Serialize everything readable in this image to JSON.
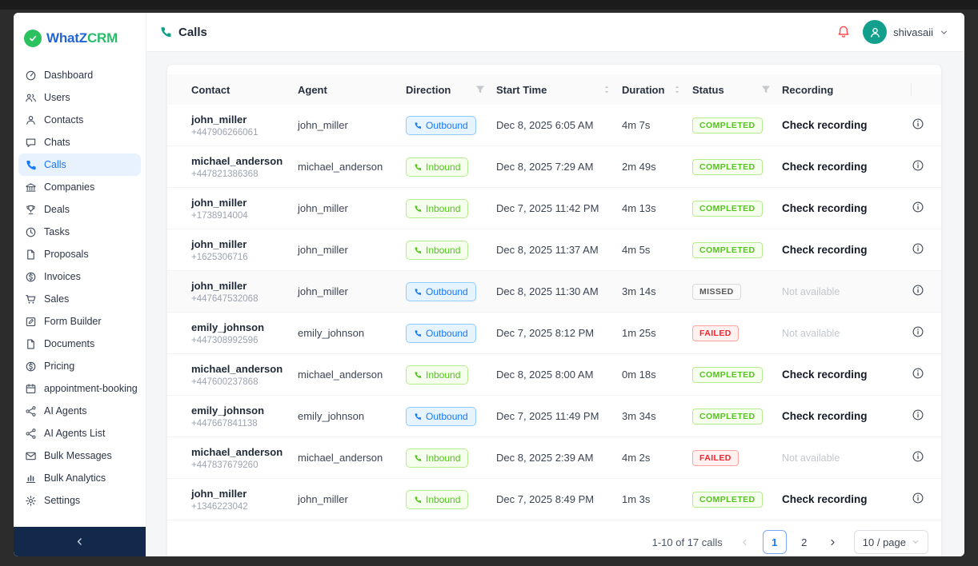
{
  "colors": {
    "accent": "#1677ff",
    "logo_blue": "#2465d6",
    "logo_green": "#27bd68",
    "brand_green": "#2bc15f",
    "teal": "#12a08d",
    "bell_red": "#ff4d4f",
    "navy": "#13294b",
    "sidebar_active_bg": "#e7f2fe"
  },
  "logo": {
    "part1": "WhatZ",
    "part2": "CRM"
  },
  "sidebar": {
    "items": [
      {
        "label": "Dashboard",
        "icon": "dashboard-icon",
        "active": false
      },
      {
        "label": "Users",
        "icon": "team-icon",
        "active": false
      },
      {
        "label": "Contacts",
        "icon": "contact-icon",
        "active": false
      },
      {
        "label": "Chats",
        "icon": "chat-icon",
        "active": false
      },
      {
        "label": "Calls",
        "icon": "phone-icon",
        "active": true
      },
      {
        "label": "Companies",
        "icon": "bank-icon",
        "active": false
      },
      {
        "label": "Deals",
        "icon": "trophy-icon",
        "active": false
      },
      {
        "label": "Tasks",
        "icon": "clock-icon",
        "active": false
      },
      {
        "label": "Proposals",
        "icon": "file-icon",
        "active": false
      },
      {
        "label": "Invoices",
        "icon": "dollar-icon",
        "active": false
      },
      {
        "label": "Sales",
        "icon": "cart-icon",
        "active": false
      },
      {
        "label": "Form Builder",
        "icon": "form-icon",
        "active": false
      },
      {
        "label": "Documents",
        "icon": "file-icon",
        "active": false
      },
      {
        "label": "Pricing",
        "icon": "dollar-icon",
        "active": false
      },
      {
        "label": "appointment-booking",
        "icon": "calendar-icon",
        "active": false
      },
      {
        "label": "AI Agents",
        "icon": "nodes-icon",
        "active": false
      },
      {
        "label": "AI Agents List",
        "icon": "nodes-icon",
        "active": false
      },
      {
        "label": "Bulk Messages",
        "icon": "mail-icon",
        "active": false
      },
      {
        "label": "Bulk Analytics",
        "icon": "chart-icon",
        "active": false
      },
      {
        "label": "Settings",
        "icon": "gear-icon",
        "active": false
      }
    ]
  },
  "header": {
    "title": "Calls",
    "user": "shivasaii"
  },
  "table": {
    "columns": [
      {
        "label": "Contact",
        "control": null
      },
      {
        "label": "Agent",
        "control": null
      },
      {
        "label": "Direction",
        "control": "filter"
      },
      {
        "label": "Start Time",
        "control": "sorter"
      },
      {
        "label": "Duration",
        "control": "sorter"
      },
      {
        "label": "Status",
        "control": "filter"
      },
      {
        "label": "Recording",
        "control": null
      },
      {
        "label": "",
        "control": null
      }
    ],
    "rows": [
      {
        "contact": "john_miller",
        "phone": "+447906266061",
        "agent": "john_miller",
        "direction": "Outbound",
        "start_time": "Dec 8, 2025 6:05 AM",
        "duration": "4m 7s",
        "status": "COMPLETED",
        "recording": "Check recording",
        "recording_available": true,
        "highlighted": false
      },
      {
        "contact": "michael_anderson",
        "phone": "+447821386368",
        "agent": "michael_anderson",
        "direction": "Inbound",
        "start_time": "Dec 8, 2025 7:29 AM",
        "duration": "2m 49s",
        "status": "COMPLETED",
        "recording": "Check recording",
        "recording_available": true,
        "highlighted": false
      },
      {
        "contact": "john_miller",
        "phone": "+1738914004",
        "agent": "john_miller",
        "direction": "Inbound",
        "start_time": "Dec 7, 2025 11:42 PM",
        "duration": "4m 13s",
        "status": "COMPLETED",
        "recording": "Check recording",
        "recording_available": true,
        "highlighted": false
      },
      {
        "contact": "john_miller",
        "phone": "+1625306716",
        "agent": "john_miller",
        "direction": "Inbound",
        "start_time": "Dec 8, 2025 11:37 AM",
        "duration": "4m 5s",
        "status": "COMPLETED",
        "recording": "Check recording",
        "recording_available": true,
        "highlighted": false
      },
      {
        "contact": "john_miller",
        "phone": "+447647532068",
        "agent": "john_miller",
        "direction": "Outbound",
        "start_time": "Dec 8, 2025 11:30 AM",
        "duration": "3m 14s",
        "status": "MISSED",
        "recording": "Not available",
        "recording_available": false,
        "highlighted": true
      },
      {
        "contact": "emily_johnson",
        "phone": "+447308992596",
        "agent": "emily_johnson",
        "direction": "Outbound",
        "start_time": "Dec 7, 2025 8:12 PM",
        "duration": "1m 25s",
        "status": "FAILED",
        "recording": "Not available",
        "recording_available": false,
        "highlighted": false
      },
      {
        "contact": "michael_anderson",
        "phone": "+447600237868",
        "agent": "michael_anderson",
        "direction": "Inbound",
        "start_time": "Dec 8, 2025 8:00 AM",
        "duration": "0m 18s",
        "status": "COMPLETED",
        "recording": "Check recording",
        "recording_available": true,
        "highlighted": false
      },
      {
        "contact": "emily_johnson",
        "phone": "+447667841138",
        "agent": "emily_johnson",
        "direction": "Outbound",
        "start_time": "Dec 7, 2025 11:49 PM",
        "duration": "3m 34s",
        "status": "COMPLETED",
        "recording": "Check recording",
        "recording_available": true,
        "highlighted": false
      },
      {
        "contact": "michael_anderson",
        "phone": "+447837679260",
        "agent": "michael_anderson",
        "direction": "Inbound",
        "start_time": "Dec 8, 2025 2:39 AM",
        "duration": "4m 2s",
        "status": "FAILED",
        "recording": "Not available",
        "recording_available": false,
        "highlighted": false
      },
      {
        "contact": "john_miller",
        "phone": "+1346223042",
        "agent": "john_miller",
        "direction": "Inbound",
        "start_time": "Dec 7, 2025 8:49 PM",
        "duration": "1m 3s",
        "status": "COMPLETED",
        "recording": "Check recording",
        "recording_available": true,
        "highlighted": false
      }
    ]
  },
  "direction_styles": {
    "Outbound": {
      "bg": "#e6f4ff",
      "border": "#91caff",
      "color": "#1677ff"
    },
    "Inbound": {
      "bg": "#f6ffed",
      "border": "#b7eb8f",
      "color": "#52c41a"
    }
  },
  "status_styles": {
    "COMPLETED": {
      "bg": "#f6ffed",
      "border": "#b7eb8f",
      "color": "#52c41a"
    },
    "MISSED": {
      "bg": "#fafafa",
      "border": "#d9d9d9",
      "color": "#595959"
    },
    "FAILED": {
      "bg": "#fff1f0",
      "border": "#ffa39e",
      "color": "#f5222d"
    }
  },
  "pagination": {
    "total_text": "1-10 of 17 calls",
    "pages": [
      "1",
      "2"
    ],
    "active_page": "1",
    "page_size_label": "10 / page"
  }
}
